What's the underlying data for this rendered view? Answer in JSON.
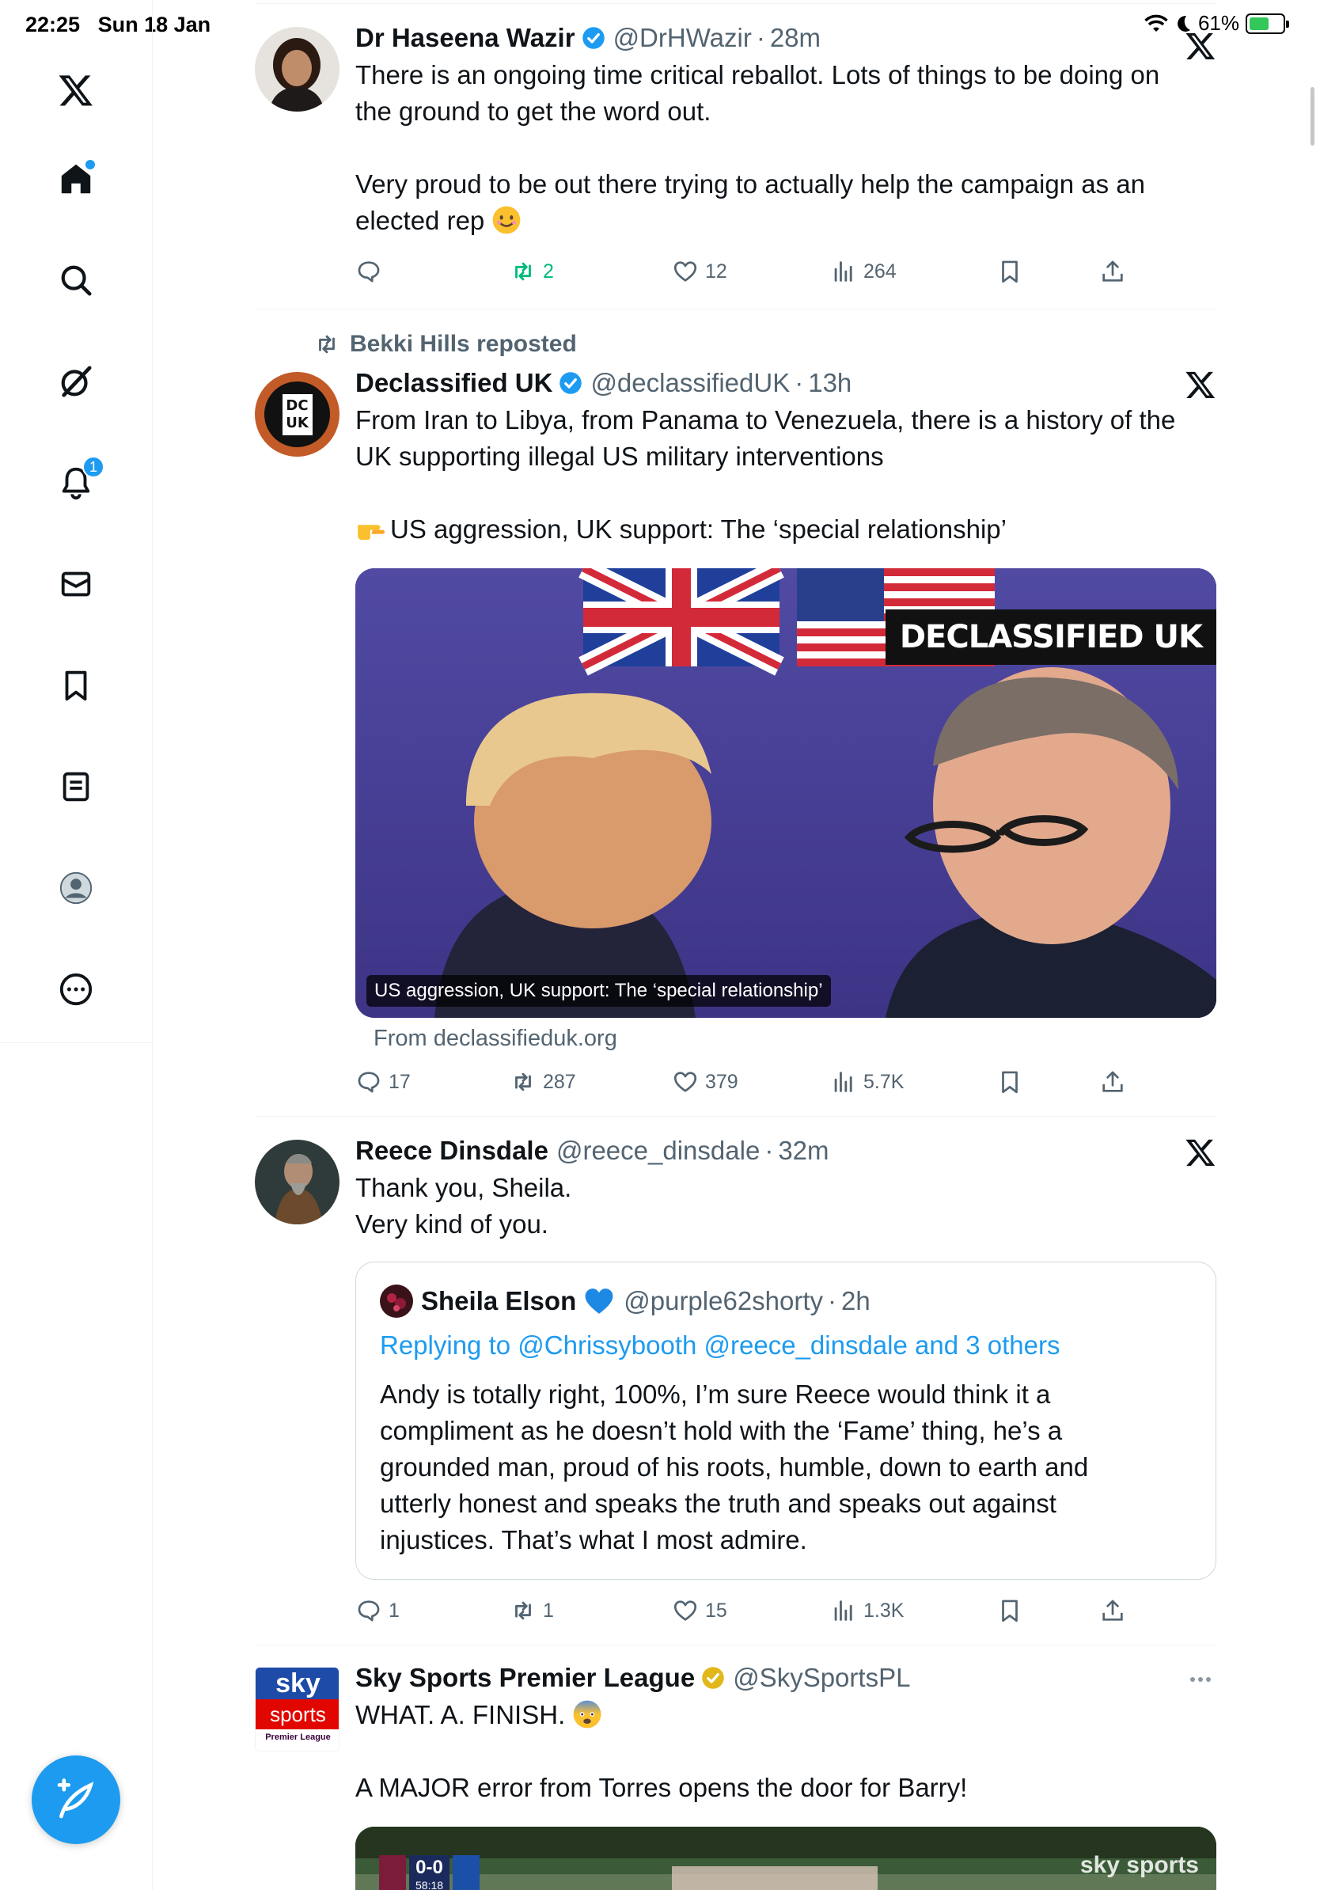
{
  "status_bar": {
    "time": "22:25",
    "date": "Sun 18 Jan",
    "battery": "61%",
    "battery_level": 0.61
  },
  "sidebar": {
    "items": [
      {
        "name": "Home",
        "icon": "home-icon"
      },
      {
        "name": "Search",
        "icon": "search-icon"
      },
      {
        "name": "Grok",
        "icon": "grok-icon"
      },
      {
        "name": "Notifications",
        "icon": "bell-icon",
        "badge": "1"
      },
      {
        "name": "Messages",
        "icon": "mail-icon"
      },
      {
        "name": "Bookmarks",
        "icon": "bookmark-icon"
      },
      {
        "name": "Lists",
        "icon": "list-icon"
      },
      {
        "name": "Profile",
        "icon": "avatar-icon"
      },
      {
        "name": "More",
        "icon": "more-icon"
      }
    ]
  },
  "tweets": [
    {
      "name": "Dr Haseena Wazir",
      "handle": "@DrHWazir",
      "time": "28m",
      "text1": "There is an ongoing time critical reballot. Lots of things to be doing on",
      "text2": "the ground to get the word out.",
      "text3": "Very proud to be out there trying to actually help the campaign as an",
      "text4": "elected rep",
      "reposts": "2",
      "likes": "12",
      "views": "264"
    },
    {
      "reposted_by": "Bekki Hills reposted",
      "name": "Declassified UK",
      "handle": "@declassifiedUK",
      "time": "13h",
      "avatar_text1": "DC",
      "avatar_text2": "UK",
      "text1": "From Iran to Libya, from Panama to Venezuela, there is a history of the",
      "text2": "UK supporting illegal US military interventions",
      "text3": "US aggression, UK support: The ‘special relationship’",
      "card_brand": "DECLASSIFIED UK",
      "card_caption": "US aggression, UK support: The ‘special relationship’",
      "card_source": "From declassifieduk.org",
      "replies": "17",
      "reposts": "287",
      "likes": "379",
      "views": "5.7K"
    },
    {
      "name": "Reece Dinsdale",
      "handle": "@reece_dinsdale",
      "time": "32m",
      "text1": "Thank you, Sheila.",
      "text2": "Very kind of you.",
      "quote": {
        "name": "Sheila Elson",
        "handle": "@purple62shorty",
        "time": "2h",
        "replying": "Replying to @Chrissybooth @reece_dinsdale and 3 others",
        "line1": "Andy is totally right, 100%, I’m sure Reece would think it a",
        "line2": "compliment as he doesn’t hold with the ‘Fame’ thing, he’s a",
        "line3": "grounded man, proud of his roots, humble, down to earth and",
        "line4": "utterly honest and speaks the truth and speaks out against",
        "line5": "injustices. That’s what I most admire."
      },
      "replies": "1",
      "reposts": "1",
      "likes": "15",
      "views": "1.3K"
    },
    {
      "name": "Sky Sports Premier League",
      "handle": "@SkySportsPL",
      "avatar_sky": "sky",
      "avatar_sports": "sports",
      "avatar_pl": "Premier League",
      "text1": "WHAT. A. FINISH.",
      "text2": "A MAJOR error from Torres opens the door for Barry!",
      "video_score": "0-0",
      "video_clock": "58:18",
      "video_brand": "sky sports"
    }
  ],
  "colors": {
    "accent": "#1d9bf0",
    "repost_green": "#00ba7c",
    "text": "#0f1419",
    "muted": "#536471"
  }
}
